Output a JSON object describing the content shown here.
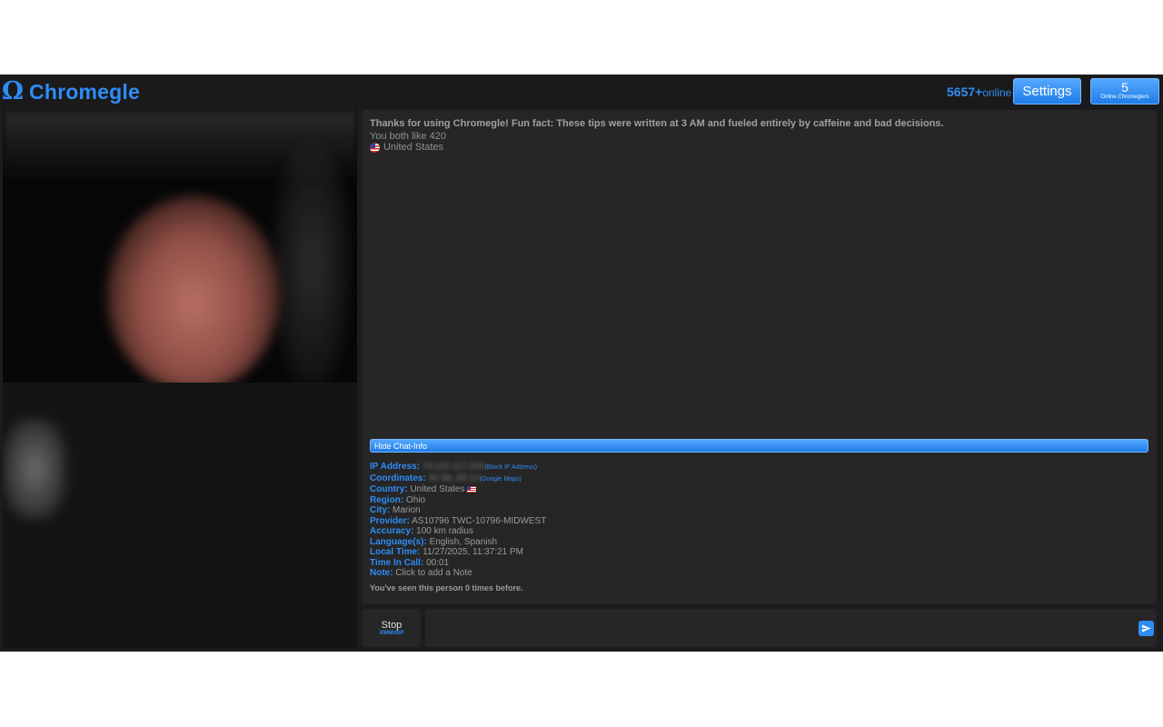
{
  "header": {
    "logo_symbol": "Ω",
    "logo_text": "Chromegle",
    "online_number": "5657+",
    "online_label": "online",
    "settings_label": "Settings",
    "chromeglers_count": "5",
    "chromeglers_label": "Online Chromeglers"
  },
  "chat": {
    "tip": "Thanks for using Chromegle! Fun fact: These tips were written at 3 AM and fueled entirely by caffeine and bad decisions.",
    "likes": "You both like 420",
    "country": "United States",
    "hide_info_label": "Hide Chat-Info",
    "info": {
      "ip_label": "IP Address:",
      "ip_value": "74.141.117.200",
      "ip_link": "(Block IP Address)",
      "coords_label": "Coordinates:",
      "coords_value": "40.58,-83.12",
      "coords_link": "(Google Maps)",
      "country_label": "Country:",
      "country_value": "United States",
      "region_label": "Region:",
      "region_value": "Ohio",
      "city_label": "City:",
      "city_value": "Marion",
      "provider_label": "Provider:",
      "provider_value": "AS10796 TWC-10796-MIDWEST",
      "accuracy_label": "Accuracy:",
      "accuracy_value": "100 km radius",
      "languages_label": "Language(s):",
      "languages_value": "English, Spanish",
      "local_time_label": "Local Time:",
      "local_time_value": "11/27/2025, 11:37:21 PM",
      "time_in_call_label": "Time In Call:",
      "time_in_call_value": "00:01",
      "note_label": "Note:",
      "note_value": "Click to add a Note"
    },
    "seen": "You've seen this person 0 times before."
  },
  "controls": {
    "stop_label": "Stop",
    "stop_code": "XWMVDP",
    "message_placeholder": ""
  },
  "colors": {
    "accent": "#2f8cf5",
    "background": "#1b1c1d",
    "panel": "#262626"
  }
}
